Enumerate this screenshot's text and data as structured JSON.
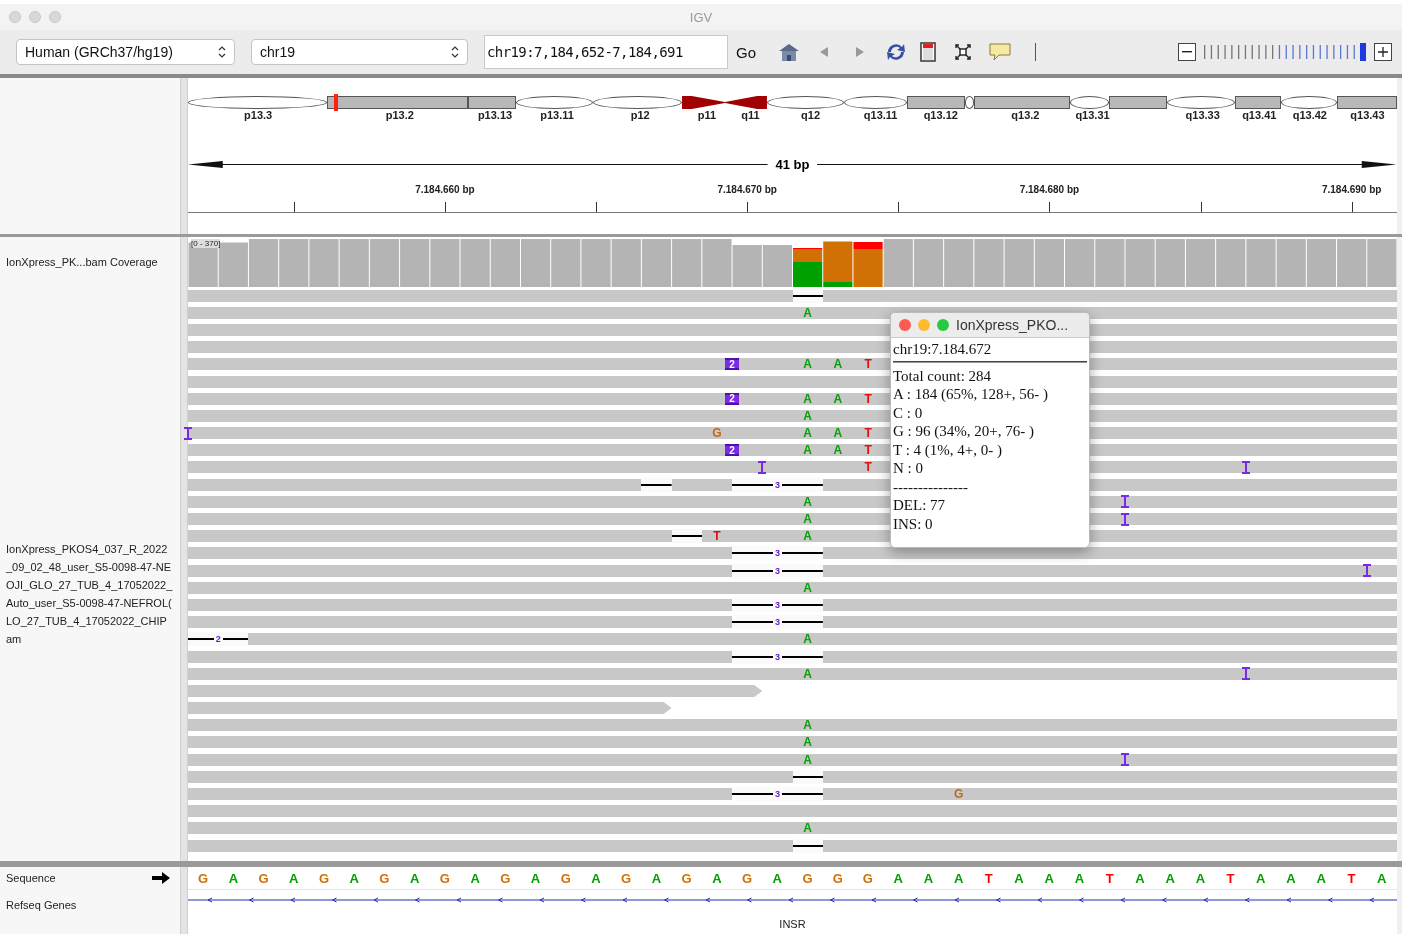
{
  "window": {
    "title": "IGV"
  },
  "toolbar": {
    "genome": "Human (GRCh37/hg19)",
    "chromosome": "chr19",
    "locus": "chr19:7,184,652-7,184,691",
    "go": "Go",
    "zoom": {
      "level": 1
    }
  },
  "ideogram": {
    "bands": [
      {
        "label": "p13.3",
        "kind": "light"
      },
      {
        "label": "p13.2",
        "kind": "dark"
      },
      {
        "label": "p13.13",
        "kind": "dark"
      },
      {
        "label": "p13.11",
        "kind": "light"
      },
      {
        "label": "p12",
        "kind": "light"
      },
      {
        "label": "p11",
        "kind": "centromere_left"
      },
      {
        "label": "q11",
        "kind": "centromere_right"
      },
      {
        "label": "q12",
        "kind": "light"
      },
      {
        "label": "q13.11",
        "kind": "light"
      },
      {
        "label": "q13.12",
        "kind": "dark"
      },
      {
        "kind": "light"
      },
      {
        "label": "q13.2",
        "kind": "dark"
      },
      {
        "label": "q13.31",
        "kind": "light"
      },
      {
        "kind": "dark"
      },
      {
        "label": "q13.33",
        "kind": "light"
      },
      {
        "label": "q13.41",
        "kind": "dark"
      },
      {
        "label": "q13.42",
        "kind": "light"
      },
      {
        "label": "q13.43",
        "kind": "dark"
      }
    ]
  },
  "ruler": {
    "width_label": "41 bp",
    "tick_labels": [
      "7.184.660 bp",
      "7.184.670 bp",
      "7.184.680 bp",
      "7.184.690 bp"
    ]
  },
  "coverage_track": {
    "name": "IonXpress_PK...bam Coverage",
    "range_label": "[0 - 370]"
  },
  "alignment_track": {
    "name_lines": [
      "IonXpress_PKOS4_037_R_2022",
      "_09_02_48_user_S5-0098-47-NE",
      "OJI_GLO_27_TUB_4_17052022_",
      "Auto_user_S5-0098-47-NEFROL(",
      "LO_27_TUB_4_17052022_CHIP",
      "am"
    ],
    "rows": [
      {
        "kind": "full",
        "marks": [
          {
            "kind": "del"
          }
        ]
      },
      {
        "kind": "full",
        "marks": [
          {
            "kind": "base",
            "text": "A",
            "color": "#0a9e0a"
          }
        ]
      },
      {
        "kind": "full",
        "marks": []
      },
      {
        "kind": "full",
        "marks": []
      },
      {
        "kind": "full",
        "marks": [
          {
            "kind": "ins",
            "text": "2"
          },
          {
            "kind": "base",
            "text": "A",
            "color": "#0a9e0a"
          },
          {
            "kind": "base",
            "text": "A",
            "color": "#0a9e0a"
          },
          {
            "kind": "base",
            "text": "T",
            "color": "#e01010"
          }
        ]
      },
      {
        "kind": "full",
        "marks": []
      },
      {
        "kind": "full",
        "marks": [
          {
            "kind": "ins",
            "text": "2"
          },
          {
            "kind": "base",
            "text": "A",
            "color": "#0a9e0a"
          },
          {
            "kind": "base",
            "text": "A",
            "color": "#0a9e0a"
          },
          {
            "kind": "base",
            "text": "T",
            "color": "#e01010"
          }
        ]
      },
      {
        "kind": "full",
        "marks": [
          {
            "kind": "base",
            "text": "A",
            "color": "#0a9e0a"
          }
        ]
      },
      {
        "kind": "full",
        "marks": [
          {
            "kind": "ins"
          },
          {
            "kind": "base",
            "text": "G",
            "color": "#c06a10"
          },
          {
            "kind": "base",
            "text": "A",
            "color": "#0a9e0a"
          },
          {
            "kind": "base",
            "text": "A",
            "color": "#0a9e0a"
          },
          {
            "kind": "base",
            "text": "T",
            "color": "#e01010"
          }
        ]
      },
      {
        "kind": "full",
        "marks": [
          {
            "kind": "ins",
            "text": "2"
          },
          {
            "kind": "base",
            "text": "A",
            "color": "#0a9e0a"
          },
          {
            "kind": "base",
            "text": "A",
            "color": "#0a9e0a"
          },
          {
            "kind": "base",
            "text": "T",
            "color": "#e01010"
          }
        ]
      },
      {
        "kind": "full",
        "marks": [
          {
            "kind": "ins"
          },
          {
            "kind": "base",
            "text": "T",
            "color": "#e01010"
          },
          {
            "kind": "ins"
          }
        ]
      },
      {
        "kind": "full",
        "marks": [
          {
            "kind": "del"
          },
          {
            "kind": "del",
            "text": "3"
          }
        ]
      },
      {
        "kind": "full",
        "marks": [
          {
            "kind": "base",
            "text": "A",
            "color": "#0a9e0a"
          },
          {
            "kind": "ins"
          }
        ]
      },
      {
        "kind": "full",
        "marks": [
          {
            "kind": "base",
            "text": "A",
            "color": "#0a9e0a"
          },
          {
            "kind": "ins"
          }
        ]
      },
      {
        "kind": "full",
        "marks": [
          {
            "kind": "del"
          },
          {
            "kind": "base",
            "text": "T",
            "color": "#e01010"
          },
          {
            "kind": "base",
            "text": "A",
            "color": "#0a9e0a"
          }
        ]
      },
      {
        "kind": "full",
        "marks": [
          {
            "kind": "del",
            "text": "3"
          }
        ]
      },
      {
        "kind": "full",
        "marks": [
          {
            "kind": "del",
            "text": "3"
          },
          {
            "kind": "ins"
          }
        ]
      },
      {
        "kind": "full",
        "marks": [
          {
            "kind": "base",
            "text": "A",
            "color": "#0a9e0a"
          }
        ]
      },
      {
        "kind": "full",
        "marks": [
          {
            "kind": "del",
            "text": "3"
          }
        ]
      },
      {
        "kind": "full",
        "marks": [
          {
            "kind": "del",
            "text": "3"
          }
        ]
      },
      {
        "kind": "full",
        "marks": [
          {
            "kind": "del",
            "text": "2"
          },
          {
            "kind": "base",
            "text": "A",
            "color": "#0a9e0a"
          }
        ]
      },
      {
        "kind": "full",
        "marks": [
          {
            "kind": "del",
            "text": "3"
          }
        ]
      },
      {
        "kind": "full",
        "marks": [
          {
            "kind": "base",
            "text": "A",
            "color": "#0a9e0a"
          },
          {
            "kind": "ins"
          }
        ]
      },
      {
        "kind": "partial",
        "marks": []
      },
      {
        "kind": "partial",
        "marks": []
      },
      {
        "kind": "full",
        "marks": [
          {
            "kind": "base",
            "text": "A",
            "color": "#0a9e0a"
          }
        ]
      },
      {
        "kind": "full",
        "marks": [
          {
            "kind": "base",
            "text": "A",
            "color": "#0a9e0a"
          }
        ]
      },
      {
        "kind": "full",
        "marks": [
          {
            "kind": "base",
            "text": "A",
            "color": "#0a9e0a"
          },
          {
            "kind": "ins"
          }
        ]
      },
      {
        "kind": "full",
        "marks": [
          {
            "kind": "del"
          }
        ]
      },
      {
        "kind": "full",
        "marks": [
          {
            "kind": "del",
            "text": "3"
          },
          {
            "kind": "base",
            "text": "G",
            "color": "#c06a10"
          }
        ]
      },
      {
        "kind": "full",
        "marks": []
      },
      {
        "kind": "full",
        "marks": [
          {
            "kind": "base",
            "text": "A",
            "color": "#0a9e0a"
          }
        ]
      },
      {
        "kind": "full",
        "marks": [
          {
            "kind": "del"
          }
        ]
      }
    ]
  },
  "popup": {
    "title": "IonXpress_PKO...",
    "position": "chr19:7.184.672",
    "lines": [
      "Total count: 284",
      "A : 184 (65%, 128+, 56- )",
      "C : 0",
      "G : 96 (34%, 20+, 76- )",
      "T : 4 (1%, 4+, 0- )",
      "N : 0",
      "---------------",
      "DEL: 77",
      "INS: 0"
    ]
  },
  "sequence_track": {
    "name": "Sequence",
    "bases": [
      {
        "text": "G",
        "color": "#d17105"
      },
      {
        "text": "A",
        "color": "#00a000"
      },
      {
        "text": "G",
        "color": "#d17105"
      },
      {
        "text": "A",
        "color": "#00a000"
      },
      {
        "text": "G",
        "color": "#d17105"
      },
      {
        "text": "A",
        "color": "#00a000"
      },
      {
        "text": "G",
        "color": "#d17105"
      },
      {
        "text": "A",
        "color": "#00a000"
      },
      {
        "text": "G",
        "color": "#d17105"
      },
      {
        "text": "A",
        "color": "#00a000"
      },
      {
        "text": "G",
        "color": "#d17105"
      },
      {
        "text": "A",
        "color": "#00a000"
      },
      {
        "text": "G",
        "color": "#d17105"
      },
      {
        "text": "A",
        "color": "#00a000"
      },
      {
        "text": "G",
        "color": "#d17105"
      },
      {
        "text": "A",
        "color": "#00a000"
      },
      {
        "text": "G",
        "color": "#d17105"
      },
      {
        "text": "A",
        "color": "#00a000"
      },
      {
        "text": "G",
        "color": "#d17105"
      },
      {
        "text": "A",
        "color": "#00a000"
      },
      {
        "text": "G",
        "color": "#d17105"
      },
      {
        "text": "G",
        "color": "#d17105"
      },
      {
        "text": "G",
        "color": "#d17105"
      },
      {
        "text": "A",
        "color": "#00a000"
      },
      {
        "text": "A",
        "color": "#00a000"
      },
      {
        "text": "A",
        "color": "#00a000"
      },
      {
        "text": "T",
        "color": "#ff0000"
      },
      {
        "text": "A",
        "color": "#00a000"
      },
      {
        "text": "A",
        "color": "#00a000"
      },
      {
        "text": "A",
        "color": "#00a000"
      },
      {
        "text": "T",
        "color": "#ff0000"
      },
      {
        "text": "A",
        "color": "#00a000"
      },
      {
        "text": "A",
        "color": "#00a000"
      },
      {
        "text": "A",
        "color": "#00a000"
      },
      {
        "text": "T",
        "color": "#ff0000"
      },
      {
        "text": "A",
        "color": "#00a000"
      },
      {
        "text": "A",
        "color": "#00a000"
      },
      {
        "text": "A",
        "color": "#00a000"
      },
      {
        "text": "T",
        "color": "#ff0000"
      },
      {
        "text": "A",
        "color": "#00a000"
      }
    ]
  },
  "gene_track": {
    "name": "Refseq Genes",
    "gene": "INSR"
  }
}
